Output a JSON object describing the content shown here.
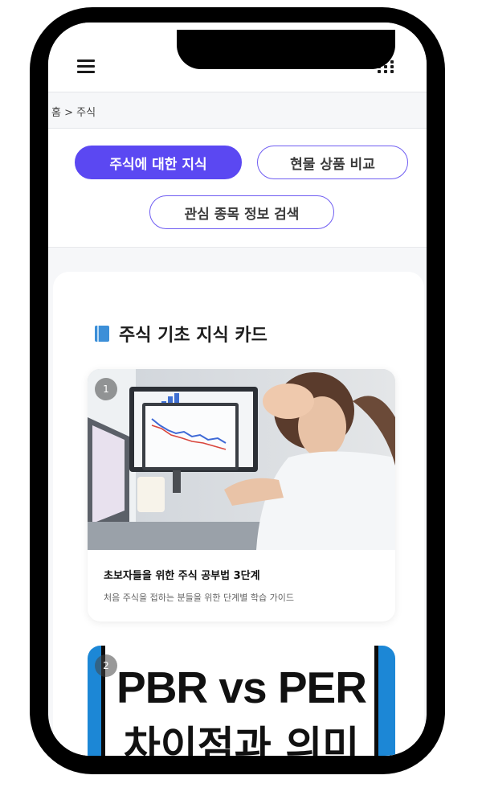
{
  "header": {
    "menu_icon": "hamburger-menu-icon",
    "apps_icon": "grid-dots-icon"
  },
  "breadcrumb": {
    "text": "홈 > 주식"
  },
  "tabs": [
    {
      "label": "주식에 대한 지식",
      "active": true
    },
    {
      "label": "현물 상품 비교",
      "active": false
    },
    {
      "label": "관심 종목 정보 검색",
      "active": false
    }
  ],
  "colors": {
    "accent": "#5b48f2",
    "outline": "#6f5df2",
    "book_icon": "#3c8fd8"
  },
  "section": {
    "title": "주식 기초 지식 카드",
    "icon": "blue-book-icon"
  },
  "cards": [
    {
      "index": "1",
      "title": "초보자들을 위한 주식 공부법 3단계",
      "description": "처음 주식을 접하는 분들을 위한 단계별 학습 가이드"
    },
    {
      "index": "2",
      "thumb_line1": "PBR vs PER",
      "thumb_line2": "차이점과 의미"
    }
  ]
}
